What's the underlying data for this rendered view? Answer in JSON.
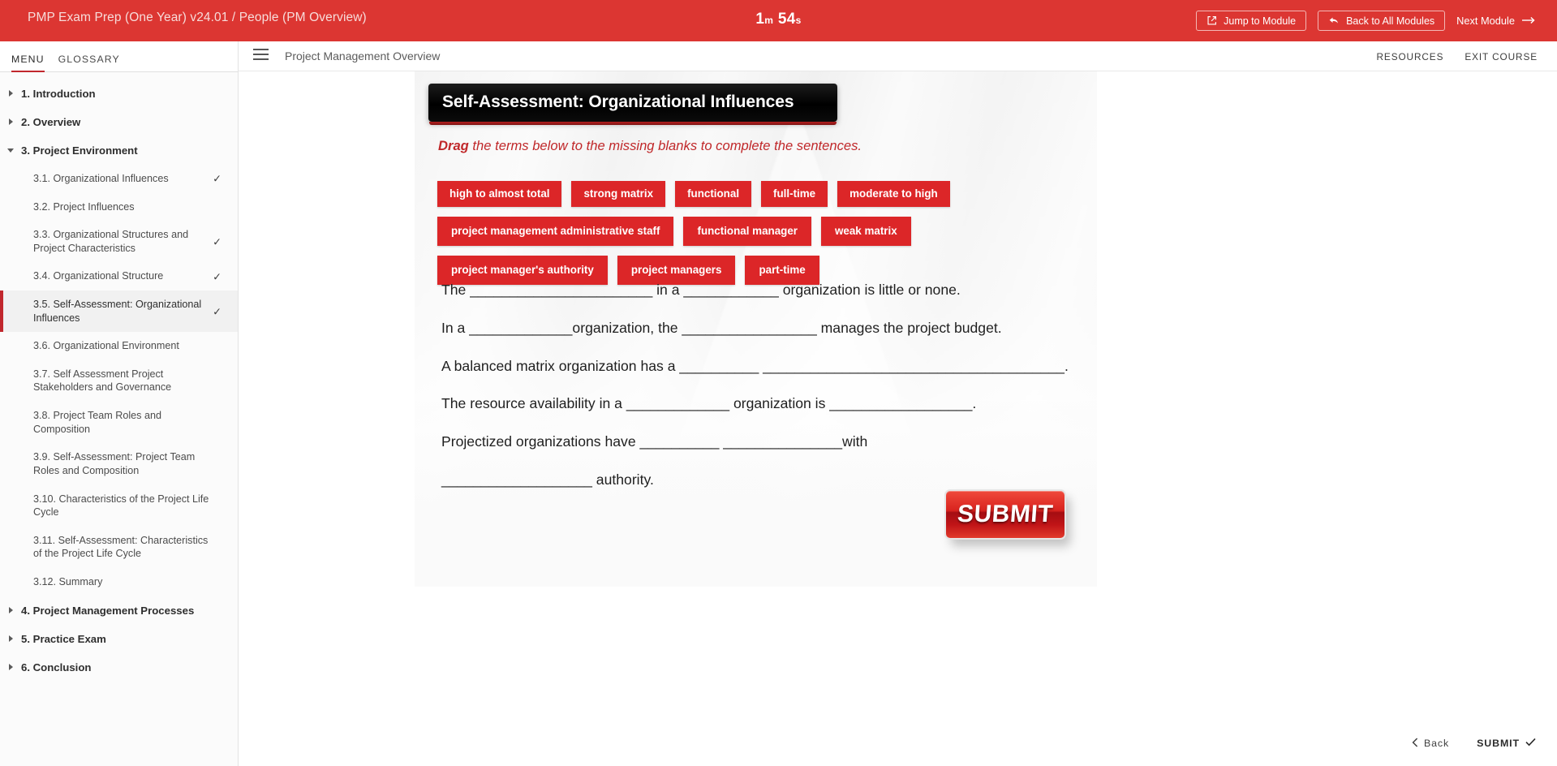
{
  "topbar": {
    "course_title": "PMP Exam Prep (One Year) v24.01 / People (PM Overview)",
    "timer_minutes": "1",
    "timer_minutes_unit": "m",
    "timer_seconds": "54",
    "timer_seconds_unit": "s",
    "jump_to_module": "Jump to Module",
    "back_to_all_modules": "Back to All Modules",
    "next_module": "Next Module",
    "accent_color": "#dc3632"
  },
  "sidebar": {
    "tabs": [
      {
        "label": "MENU",
        "active": true
      },
      {
        "label": "GLOSSARY",
        "active": false
      }
    ],
    "items": [
      {
        "label": "1. Introduction",
        "level": "top",
        "expanded": false
      },
      {
        "label": "2. Overview",
        "level": "top",
        "expanded": false
      },
      {
        "label": "3. Project Environment",
        "level": "top",
        "expanded": true
      },
      {
        "label": "3.1. Organizational Influences",
        "level": "sub",
        "complete": true
      },
      {
        "label": "3.2. Project Influences",
        "level": "sub",
        "complete": false
      },
      {
        "label": "3.3. Organizational Structures and Project Characteristics",
        "level": "sub",
        "complete": true
      },
      {
        "label": "3.4. Organizational Structure",
        "level": "sub",
        "complete": true
      },
      {
        "label": "3.5. Self-Assessment: Organizational Influences",
        "level": "sub",
        "complete": true,
        "selected": true
      },
      {
        "label": "3.6. Organizational Environment",
        "level": "sub",
        "complete": false
      },
      {
        "label": "3.7. Self Assessment Project Stakeholders and Governance",
        "level": "sub",
        "complete": false
      },
      {
        "label": "3.8. Project Team Roles and Composition",
        "level": "sub",
        "complete": false
      },
      {
        "label": "3.9. Self-Assessment: Project Team Roles and Composition",
        "level": "sub",
        "complete": false
      },
      {
        "label": "3.10. Characteristics of the Project Life Cycle",
        "level": "sub",
        "complete": false
      },
      {
        "label": "3.11. Self-Assessment: Characteristics of the Project Life Cycle",
        "level": "sub",
        "complete": false
      },
      {
        "label": "3.12. Summary",
        "level": "sub",
        "complete": false
      },
      {
        "label": "4. Project Management Processes",
        "level": "top",
        "expanded": false
      },
      {
        "label": "5. Practice Exam",
        "level": "top",
        "expanded": false
      },
      {
        "label": "6. Conclusion",
        "level": "top",
        "expanded": false
      }
    ],
    "selected_index": 7,
    "highlight_color": "#c1272d"
  },
  "header": {
    "module_name": "Project Management Overview",
    "resources": "RESOURCES",
    "exit_course": "EXIT COURSE"
  },
  "slide": {
    "title": "Self-Assessment: Organizational Influences",
    "instruction_bold": "Drag",
    "instruction_rest": " the terms below to the missing blanks to complete the sentences.",
    "instruction_color": "#c0282a",
    "chip_color": "#dc2628",
    "chip_rows": [
      [
        "high to almost total",
        "strong matrix",
        "functional",
        "full-time",
        "moderate to high"
      ],
      [
        "project management administrative staff",
        "functional manager",
        "weak matrix"
      ],
      [
        "project manager's authority",
        "project managers",
        "part-time"
      ]
    ],
    "sentences": [
      "The _______________________ in a ____________ organization is little or none.",
      "In a _____________organization, the _________________ manages the project budget.",
      "A balanced matrix organization has a __________ ______________________________________.",
      "The resource availability in a _____________ organization is __________________.",
      "Projectized organizations have __________ _______________with",
      "___________________ authority."
    ],
    "submit_label": "SUBMIT"
  },
  "bottom_nav": {
    "back": "Back",
    "submit": "SUBMIT"
  }
}
